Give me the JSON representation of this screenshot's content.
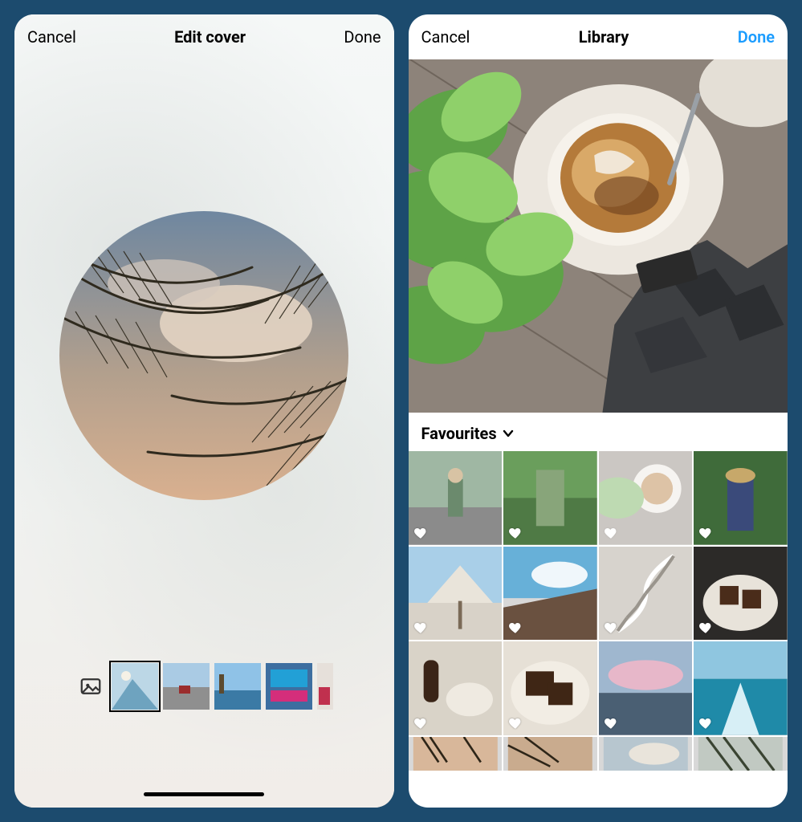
{
  "left": {
    "cancel": "Cancel",
    "title": "Edit cover",
    "done": "Done",
    "gallery_icon": "image-icon",
    "thumbs": [
      {
        "name": "cover-candidate-1",
        "selected": true
      },
      {
        "name": "cover-candidate-2",
        "selected": false
      },
      {
        "name": "cover-candidate-3",
        "selected": false
      },
      {
        "name": "cover-candidate-4",
        "selected": false
      },
      {
        "name": "cover-candidate-5",
        "selected": false
      }
    ]
  },
  "right": {
    "cancel": "Cancel",
    "title": "Library",
    "done": "Done",
    "done_accent": true,
    "section_label": "Favourites",
    "grid_items": [
      {
        "name": "photo-person-standing",
        "favorite": true,
        "faded": false
      },
      {
        "name": "photo-greenery-rail",
        "favorite": true,
        "faded": false
      },
      {
        "name": "photo-coffee-plant",
        "favorite": true,
        "faded": true
      },
      {
        "name": "photo-person-hat",
        "favorite": true,
        "faded": false
      },
      {
        "name": "photo-parasol-sky",
        "favorite": true,
        "faded": false
      },
      {
        "name": "photo-roof-clouds",
        "favorite": true,
        "faded": false
      },
      {
        "name": "photo-spiral-stairs",
        "favorite": true,
        "faded": false
      },
      {
        "name": "photo-dessert-plate",
        "favorite": true,
        "faded": false
      },
      {
        "name": "photo-table-bottle",
        "favorite": true,
        "faded": false
      },
      {
        "name": "photo-brownie-close",
        "favorite": true,
        "faded": false
      },
      {
        "name": "photo-pink-clouds-sea",
        "favorite": true,
        "faded": false
      },
      {
        "name": "photo-boat-wake-sea",
        "favorite": true,
        "faded": false
      },
      {
        "name": "photo-palm-sunset-1",
        "favorite": true,
        "faded": false
      },
      {
        "name": "photo-palm-sunset-2",
        "favorite": true,
        "faded": false
      },
      {
        "name": "photo-palm-cloud",
        "favorite": true,
        "faded": false
      },
      {
        "name": "photo-palm-fronds",
        "favorite": true,
        "faded": false
      }
    ]
  }
}
